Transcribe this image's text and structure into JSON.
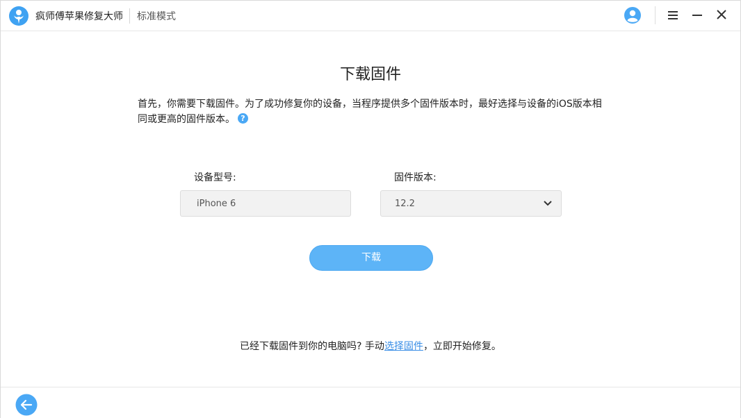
{
  "titlebar": {
    "app_name": "疯师傅苹果修复大师",
    "mode": "标准模式",
    "logo_icon": "app-logo-icon",
    "user_icon": "user-avatar-icon",
    "menu_icon": "hamburger-menu-icon",
    "minimize_icon": "minimize-icon",
    "close_icon": "close-icon"
  },
  "main": {
    "title": "下载固件",
    "description": "首先，你需要下载固件。为了成功修复你的设备，当程序提供多个固件版本时，最好选择与设备的iOS版本相同或更高的固件版本。",
    "help_glyph": "?",
    "device_model_label": "设备型号:",
    "device_model_value": "iPhone 6",
    "firmware_label": "固件版本:",
    "firmware_value": "12.2",
    "download_label": "下载"
  },
  "footer": {
    "note_prefix": "已经下载固件到你的电脑吗? 手动",
    "note_link": "选择固件",
    "note_suffix": "，立即开始修复。"
  },
  "bottombar": {
    "back_icon": "back-arrow-icon"
  },
  "colors": {
    "accent": "#5db4f7",
    "link": "#3a8ee6",
    "icon_blue": "#4aa8f5"
  }
}
